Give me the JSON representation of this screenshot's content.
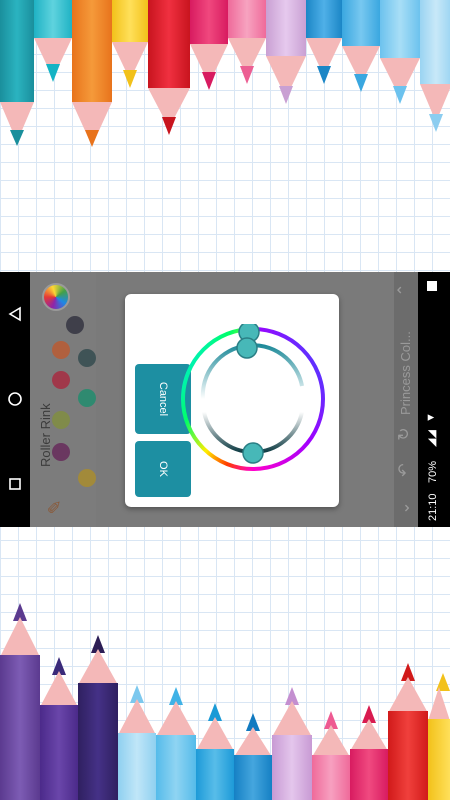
{
  "app": {
    "title": "Princess Col...",
    "canvas_label": "Roller Rink"
  },
  "status_bar": {
    "battery": "70%",
    "time": "21:10"
  },
  "dialog": {
    "cancel_label": "Cancel",
    "ok_label": "OK"
  },
  "palette_colors": [
    "#3f3f4a",
    "#b0603e",
    "#3f5356",
    "#a0384a",
    "#2f8a70",
    "#808b4a",
    "#6a3760",
    "#a28a3a"
  ],
  "accent_color": "#1d8fa2",
  "icons": [
    "back-icon",
    "home-icon",
    "recents-icon",
    "color-wheel-icon",
    "brush-icon",
    "up-icon",
    "refresh-icon",
    "undo-icon",
    "down-icon"
  ]
}
